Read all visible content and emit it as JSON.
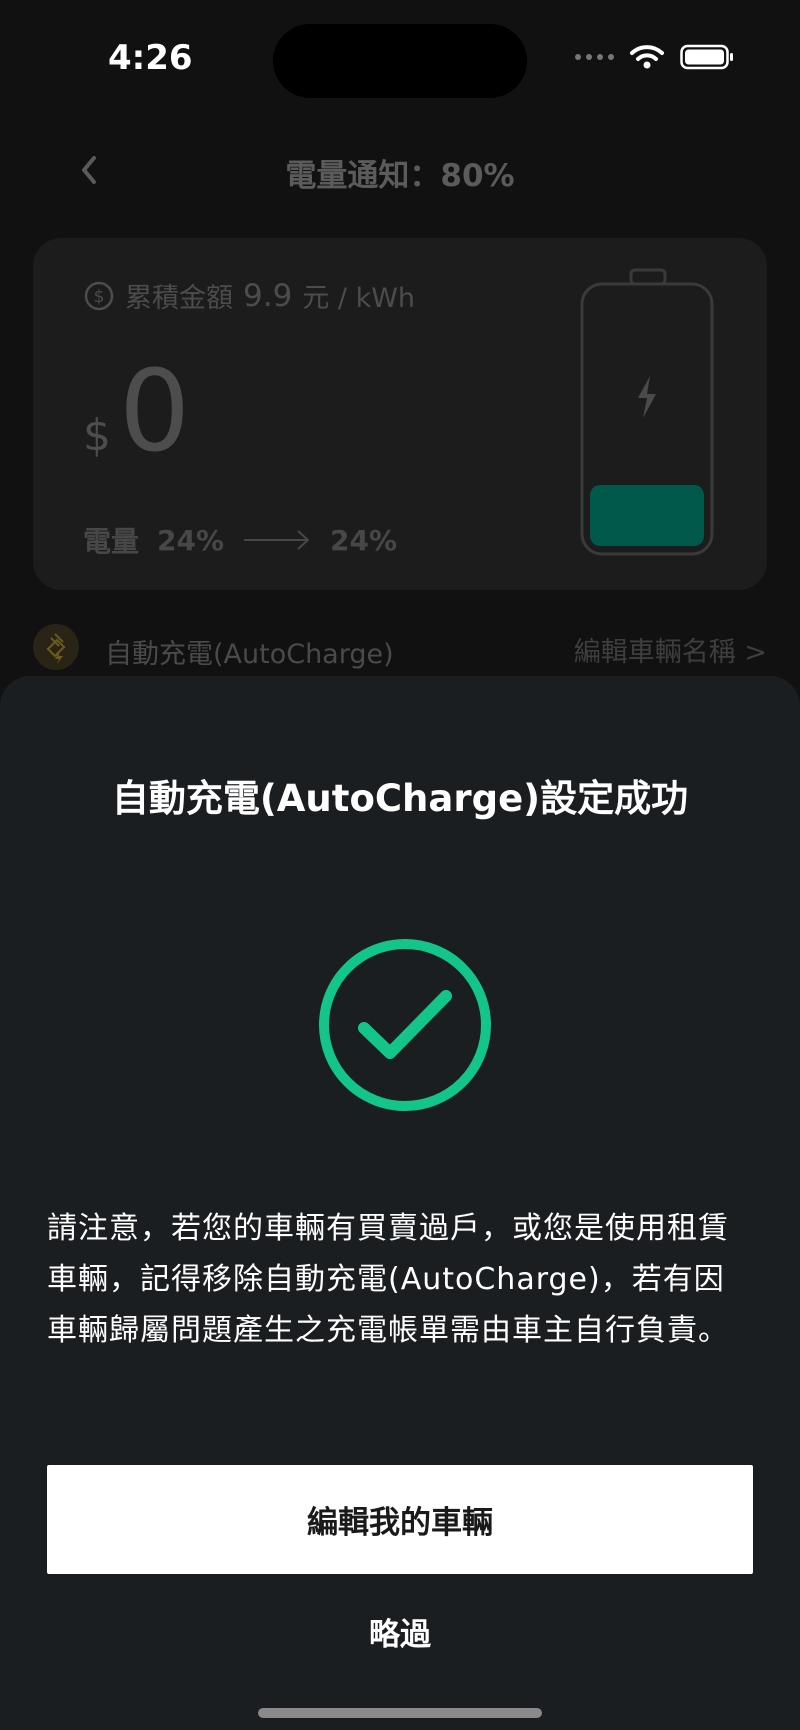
{
  "status_bar": {
    "time": "4:26"
  },
  "header": {
    "title": "電量通知：80%"
  },
  "charge_card": {
    "rate_label": "累積金額",
    "rate_value": "9.9",
    "rate_unit": "元 / kWh",
    "currency_symbol": "$",
    "amount": "0",
    "energy_label": "電量",
    "energy_start": "24%",
    "energy_end": "24%",
    "battery_level_fraction": 0.24,
    "battery_fill_color": "#00594a"
  },
  "autocharge_row": {
    "label": "自動充電(AutoCharge)",
    "edit_link": "編輯車輛名稱 >"
  },
  "sheet": {
    "title": "自動充電(AutoCharge)設定成功",
    "notice": "請注意，若您的車輛有買賣過戶，或您是使用租賃車輛，記得移除自動充電(AutoCharge)，若有因車輛歸屬問題產生之充電帳單需由車主自行負責。",
    "primary_button": "編輯我的車輛",
    "skip_button": "略過",
    "success_color": "#14c58a"
  },
  "icons": {
    "back": "chevron-left-icon",
    "success": "check-circle-icon",
    "coin": "dollar-circle-icon",
    "bolt": "bolt-icon",
    "wifi": "wifi-icon",
    "battery": "battery-icon"
  }
}
